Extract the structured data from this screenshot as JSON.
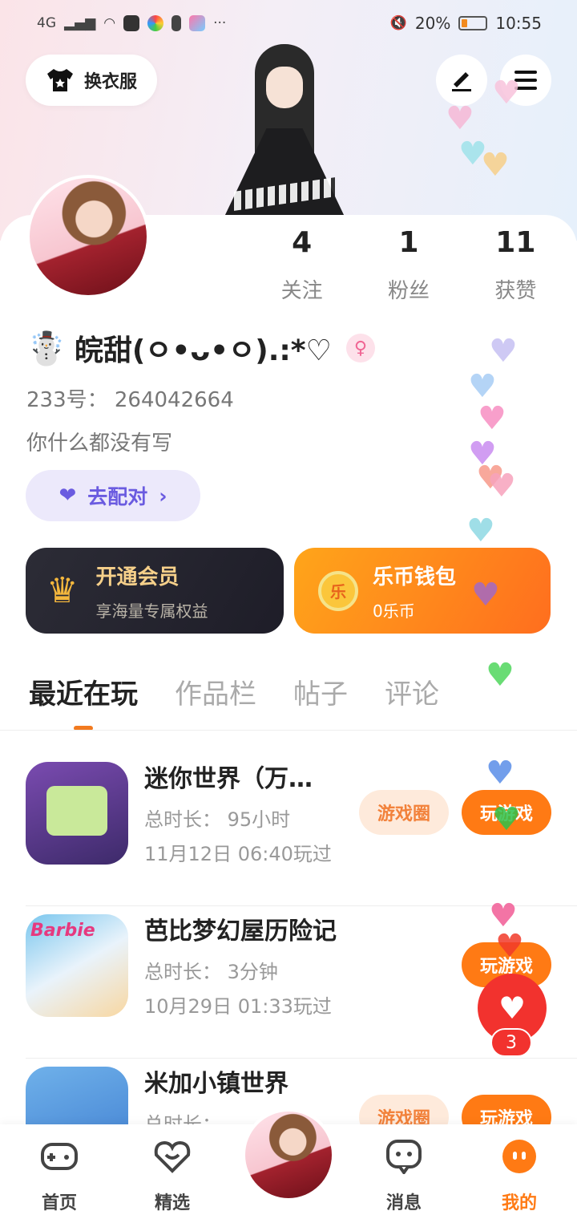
{
  "status_bar": {
    "signal": "4G",
    "mute_icon": "mute-icon",
    "battery_percent": "20%",
    "time": "10:55",
    "more": "···"
  },
  "header": {
    "dress_up_label": "换衣服",
    "edit_icon": "edit-icon",
    "menu_icon": "menu-icon"
  },
  "profile": {
    "stats": [
      {
        "value": "4",
        "label": "关注"
      },
      {
        "value": "1",
        "label": "粉丝"
      },
      {
        "value": "11",
        "label": "获赞"
      }
    ],
    "nickname": "皖甜(ㅇ•ᴗ•ㅇ).:*♡",
    "nickname_prefix_emoji": "☃️",
    "gender_symbol": "♀",
    "id_line": "233号： 264042664",
    "bio": "你什么都没有写",
    "pair_button": "去配对"
  },
  "cards": {
    "vip": {
      "title": "开通会员",
      "subtitle": "享海量专属权益"
    },
    "wallet": {
      "title": "乐币钱包",
      "subtitle": "0乐币",
      "coin_label": "乐"
    }
  },
  "tabs": [
    "最近在玩",
    "作品栏",
    "帖子",
    "评论"
  ],
  "games": [
    {
      "name": "迷你世界（万…",
      "duration": "总时长： 95小时",
      "last_played": "11月12日 06:40玩过",
      "circle_label": "游戏圈",
      "play_label": "玩游戏"
    },
    {
      "name": "芭比梦幻屋历险记",
      "duration": "总时长： 3分钟",
      "last_played": "10月29日 01:33玩过",
      "circle_label": "",
      "play_label": "玩游戏"
    },
    {
      "name": "米加小镇世界",
      "duration": "总时长： …",
      "last_played": "",
      "circle_label": "游戏圈",
      "play_label": "玩游戏"
    }
  ],
  "like": {
    "count": "3"
  },
  "bottom_nav": [
    {
      "label": "首页",
      "icon": "gamepad-icon"
    },
    {
      "label": "精选",
      "icon": "heart-badge-icon"
    },
    {
      "label": "",
      "icon": "avatar-icon"
    },
    {
      "label": "消息",
      "icon": "chat-icon"
    },
    {
      "label": "我的",
      "icon": "face-icon"
    }
  ],
  "colors": {
    "accent": "#ff7a14",
    "pair": "#6a5be0",
    "like": "#f2322e"
  }
}
